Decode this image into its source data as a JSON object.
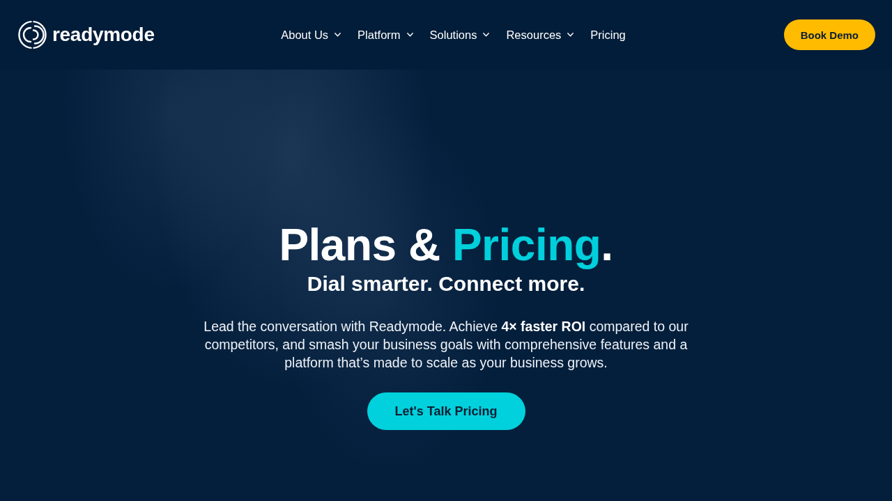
{
  "header": {
    "logo": {
      "text": "readymode"
    },
    "nav": [
      {
        "label": "About Us",
        "has_menu": true
      },
      {
        "label": "Platform",
        "has_menu": true
      },
      {
        "label": "Solutions",
        "has_menu": true
      },
      {
        "label": "Resources",
        "has_menu": true
      },
      {
        "label": "Pricing",
        "has_menu": false
      }
    ],
    "book_button": {
      "label": "Book Demo"
    }
  },
  "hero": {
    "title": [
      {
        "text": "Plans & ",
        "accent": false
      },
      {
        "text": "Pricing",
        "accent": true
      },
      {
        "text": ".",
        "accent": false
      }
    ],
    "subtitle": "Dial smarter. Connect more.",
    "body": "Lead the conversation with Readymode. Achieve **4× faster ROI** compared to our competitors, and smash your business goals with comprehensive features and a platform that’s made to scale as your business grows.",
    "cta": {
      "label": "Let's Talk Pricing"
    }
  }
}
